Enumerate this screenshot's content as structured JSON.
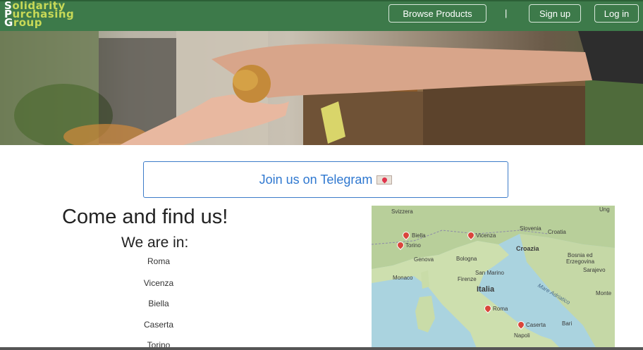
{
  "navbar": {
    "logo_lines": [
      "Solidarity",
      "Purchasing",
      "Group"
    ],
    "logo_initials": [
      "S",
      "P",
      "G"
    ],
    "logo_rest": [
      "olidarity",
      "urchasing",
      "roup"
    ],
    "browse_label": "Browse Products",
    "separator": "|",
    "signup_label": "Sign up",
    "login_label": "Log in"
  },
  "telegram": {
    "label": "Join us on Telegram"
  },
  "find": {
    "title": "Come and find us!",
    "subtitle": "We are in:",
    "cities": [
      "Roma",
      "Vicenza",
      "Biella",
      "Caserta",
      "Torino"
    ]
  },
  "map": {
    "labels": {
      "svizzera": "Svizzera",
      "ung": "Ung",
      "slovenia": "Slovenia",
      "croatia": "Croatia",
      "croazia": "Croazia",
      "bosnia": "Bosnia ed",
      "erzegovina": "Erzegovina",
      "sarajevo": "Sarajevo",
      "genova": "Genova",
      "bologna": "Bologna",
      "sanmarino": "San Marino",
      "firenze": "Firenze",
      "italia": "Italia",
      "monaco": "Monaco",
      "adriatic": "Mare Adriatico",
      "montenegro": "Monte",
      "bari": "Bari",
      "napoli": "Napoli",
      "vicenza": "Vicenza",
      "biella": "Biella",
      "torino": "Torino",
      "roma": "Roma",
      "caserta": "Caserta"
    }
  },
  "colors": {
    "navbar": "#3d7a4a",
    "logo": "#c8d957",
    "telegram_text": "#2f78d0"
  }
}
